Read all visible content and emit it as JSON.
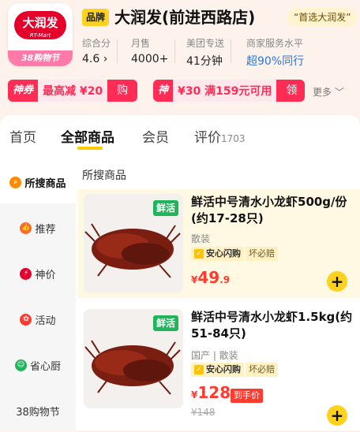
{
  "store": {
    "logo_text": "大润发",
    "logo_sub": "RT-Mart",
    "logo_event": "38购物节",
    "brand_badge": "品牌",
    "name": "大润发(前进西路店)",
    "choice_tag": "“首选大润发”",
    "stats": [
      {
        "label": "综合分",
        "value": "4.6 ›"
      },
      {
        "label": "月售",
        "value": "4000+"
      },
      {
        "label": "美团专送",
        "value": "41分钟"
      },
      {
        "label": "商家服务水平",
        "value": "超90%同行"
      }
    ]
  },
  "coupons": [
    {
      "tag": "神券",
      "text": "最高减 ¥20",
      "button": "购"
    },
    {
      "tag": "神券",
      "text": "¥30 满159元可用",
      "button": "领"
    }
  ],
  "more_label": "更多 ﹀",
  "tabs": [
    {
      "label": "首页",
      "count": ""
    },
    {
      "label": "全部商品",
      "count": ""
    },
    {
      "label": "会员",
      "count": ""
    },
    {
      "label": "评价",
      "count": "1703"
    }
  ],
  "sidebar": [
    {
      "label": "所搜商品",
      "icon": "search-icon",
      "color": "#ff8a00"
    },
    {
      "label": "推荐",
      "icon": "thumbs-up-icon",
      "color": "#ff6a2a"
    },
    {
      "label": "神价",
      "icon": "lightning-icon",
      "color": "#e4002b"
    },
    {
      "label": "活动",
      "icon": "gift-icon",
      "color": "#ff3b30"
    },
    {
      "label": "省心厨",
      "icon": "chef-icon",
      "color": "#20b55a"
    },
    {
      "label": "38购物节",
      "icon": "",
      "color": ""
    }
  ],
  "section_title": "所搜商品",
  "products": [
    {
      "fresh": "鲜活",
      "title": "鲜活中号清水小龙虾500g/份(约17-28只)",
      "origin": "散装",
      "guarantee": "安心闪购",
      "guarantee_extra": "坏必赔",
      "price_currency": "¥",
      "price_int": "49",
      "price_dec": ".9",
      "price_tag": "",
      "old_price": ""
    },
    {
      "fresh": "鲜活",
      "title": "鲜活中号清水小龙虾1.5kg(约51-84只)",
      "origin": "国产 | 散装",
      "guarantee": "安心闪购",
      "guarantee_extra": "坏必赔",
      "price_currency": "¥",
      "price_int": "128",
      "price_dec": "",
      "price_tag": "到手价",
      "old_price": "¥148"
    }
  ],
  "colors": {
    "accent": "#ffd21f",
    "price": "#ff3b30",
    "coupon": "#ff2d55",
    "fresh": "#20b55a"
  }
}
